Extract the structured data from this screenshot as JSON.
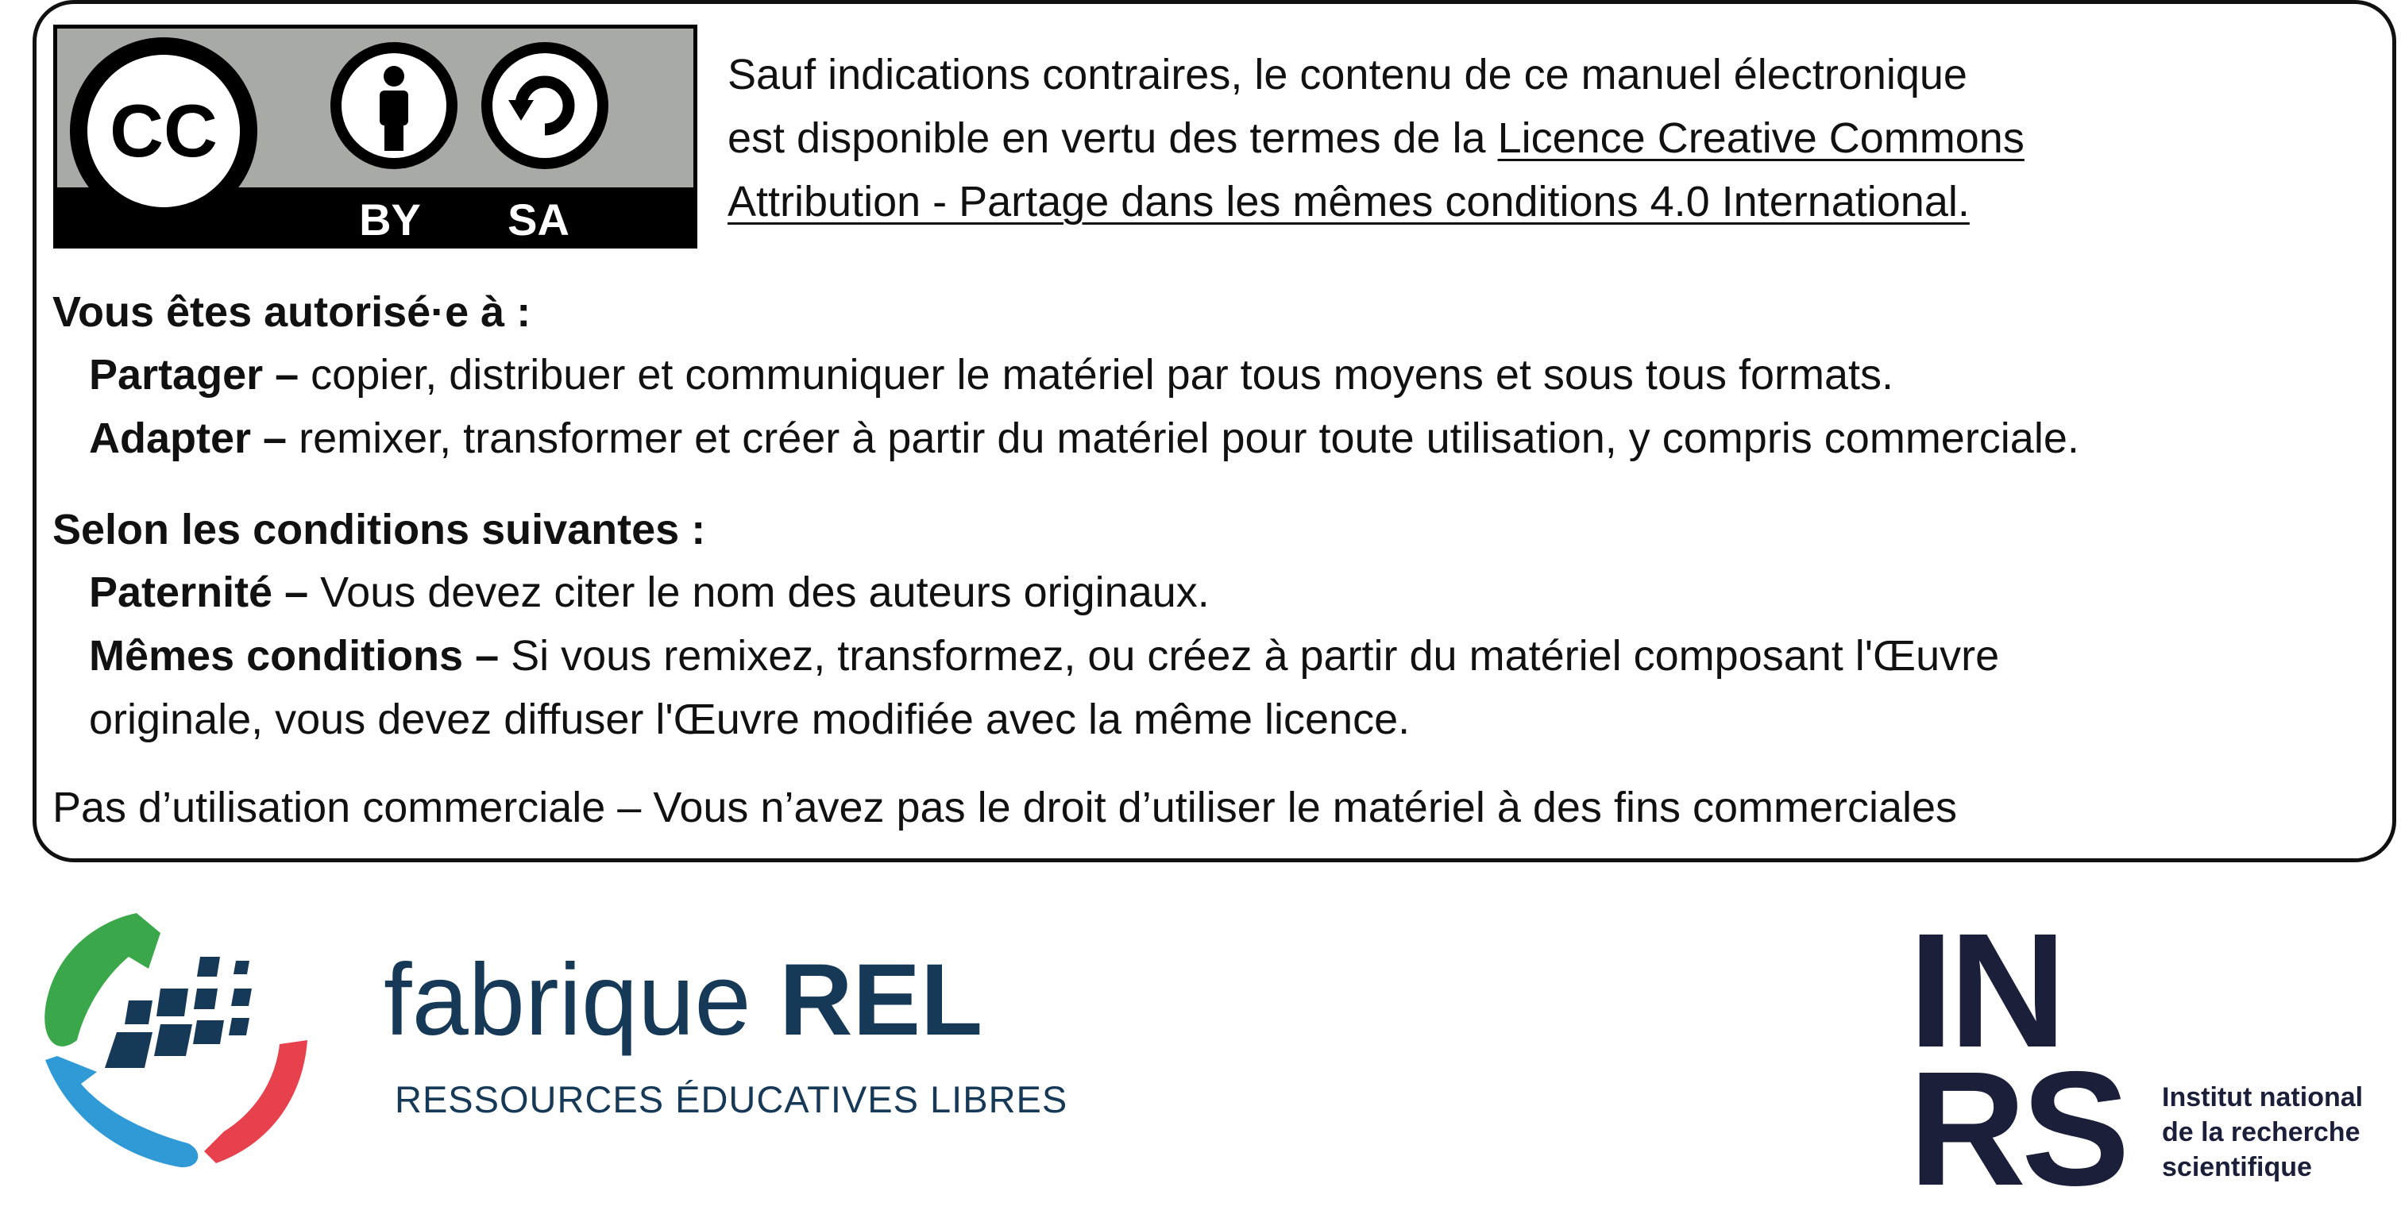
{
  "badge": {
    "cc_text": "CC",
    "by_text": "BY",
    "sa_text": "SA",
    "colors": {
      "gray": "#a8aaa6",
      "black": "#000000",
      "white": "#ffffff"
    }
  },
  "intro": {
    "line1": "Sauf indications contraires, le contenu de ce manuel électronique",
    "line2_prefix": "est disponible en vertu des termes de la ",
    "link_part1": "Licence Creative Commons ",
    "link_part2": "Attribution - Partage dans les mêmes conditions 4.0 International."
  },
  "permissions": {
    "heading": "Vous êtes autorisé·e à :",
    "items": [
      {
        "term": "Partager –",
        "text": " copier, distribuer et communiquer le matériel par tous moyens et sous tous formats."
      },
      {
        "term": "Adapter –",
        "text": " remixer, transformer et créer à partir du matériel pour toute utilisation, y compris commerciale."
      }
    ]
  },
  "conditions": {
    "heading": "Selon les conditions suivantes :",
    "items": [
      {
        "term": "Paternité –",
        "text": " Vous devez citer le nom des auteurs originaux."
      },
      {
        "term": "Mêmes conditions –",
        "text": " Si vous remixez, transformez, ou créez à partir du matériel composant l'Œuvre",
        "continuation": "originale, vous devez diffuser l'Œuvre modifiée avec la même licence."
      }
    ]
  },
  "note": "Pas d’utilisation commerciale – Vous n’avez pas le droit d’utiliser le matériel à des fins commerciales",
  "fabrique": {
    "word_light": "fabrique",
    "word_bold": "REL",
    "tagline": "RESSOURCES ÉDUCATIVES LIBRES",
    "colors": {
      "navy": "#163957",
      "green": "#3aa84a",
      "blue": "#2f9ad6",
      "red": "#e8414e"
    }
  },
  "inrs": {
    "letters_top": "IN",
    "letters_bottom": "RS",
    "caption": [
      "Institut national",
      "de la recherche",
      "scientifique"
    ],
    "color": "#1b1f3a"
  }
}
